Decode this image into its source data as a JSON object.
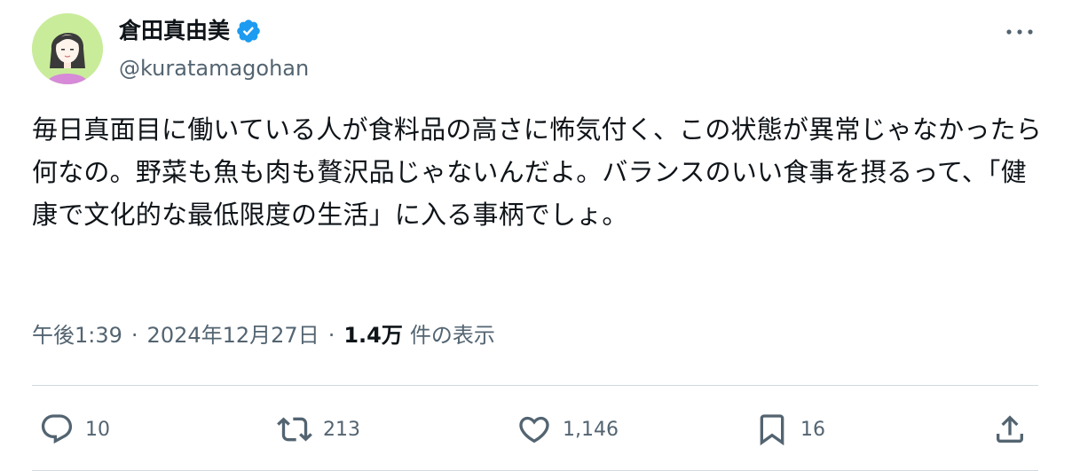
{
  "author": {
    "display_name": "倉田真由美",
    "handle": "@kuratamagohan",
    "verified": true
  },
  "tweet": {
    "text": "毎日真面目に働いている人が食料品の高さに怖気付く、この状態が異常じゃなかったら何なの。野菜も魚も肉も贅沢品じゃないんだよ。バランスのいい食事を摂るって、「健康で文化的な最低限度の生活」に入る事柄でしょ。"
  },
  "meta": {
    "time": "午後1:39",
    "separator": "·",
    "date": "2024年12月27日",
    "views_count": "1.4万",
    "views_label": "件の表示"
  },
  "actions": {
    "replies": "10",
    "retweets": "213",
    "likes": "1,146",
    "bookmarks": "16"
  },
  "icons": {
    "more": "more-horizontal-icon",
    "verified": "verified-badge-icon",
    "reply": "reply-icon",
    "retweet": "retweet-icon",
    "like": "heart-icon",
    "bookmark": "bookmark-icon",
    "share": "share-icon"
  },
  "colors": {
    "text": "#0f1419",
    "secondary": "#536471",
    "verified": "#1d9bf0",
    "divider": "#cfd9de",
    "avatar_bg": "#c9ec9a"
  }
}
